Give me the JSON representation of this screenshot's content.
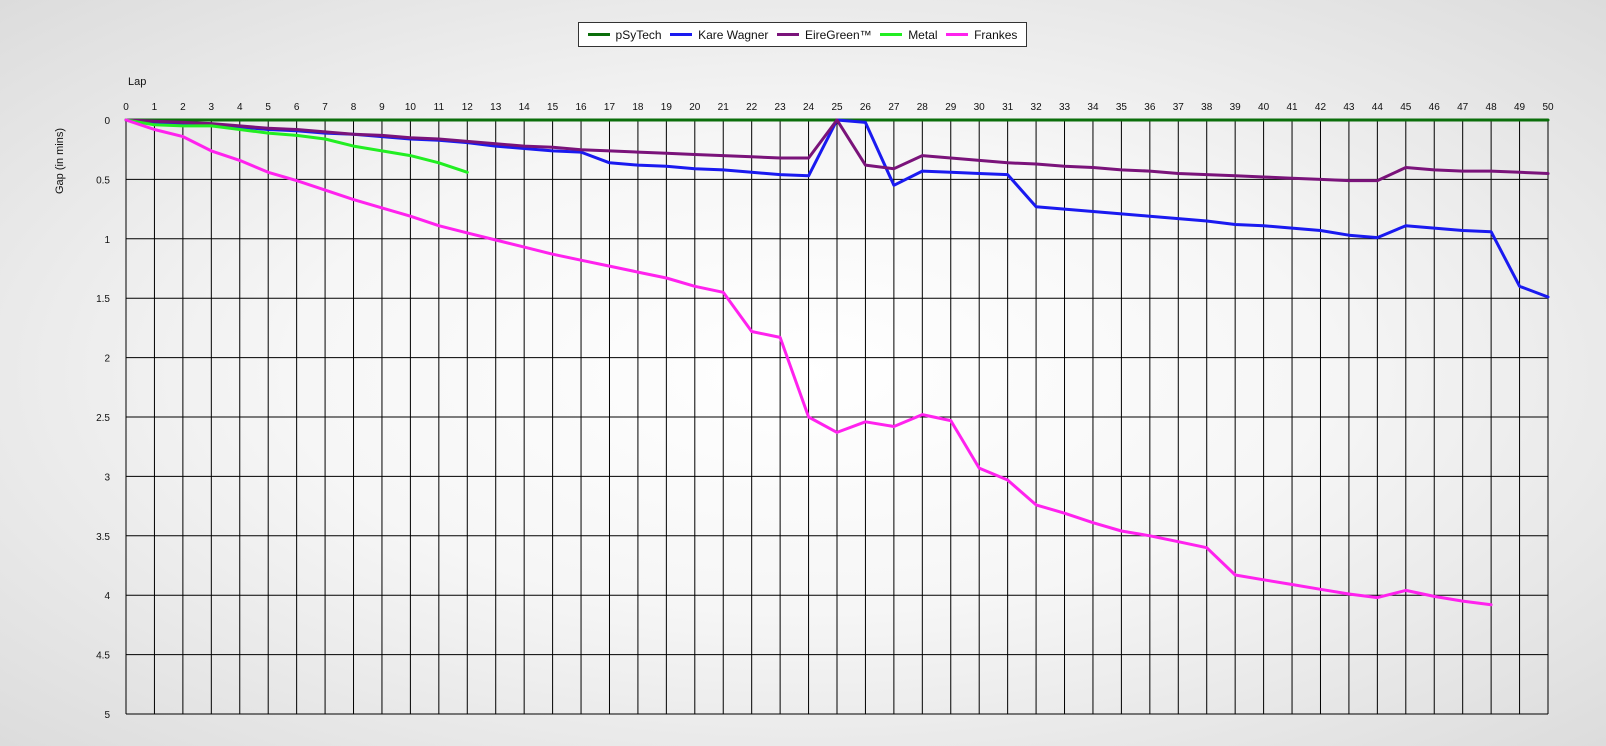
{
  "chart_data": {
    "type": "line",
    "xlabel": "Lap",
    "ylabel": "Gap (in mins)",
    "xlim": [
      0,
      50
    ],
    "ylim": [
      0,
      5
    ],
    "y_inverted": true,
    "grid": true,
    "legend_position": "top-center",
    "x_ticks": [
      0,
      1,
      2,
      3,
      4,
      5,
      6,
      7,
      8,
      9,
      10,
      11,
      12,
      13,
      14,
      15,
      16,
      17,
      18,
      19,
      20,
      21,
      22,
      23,
      24,
      25,
      26,
      27,
      28,
      29,
      30,
      31,
      32,
      33,
      34,
      35,
      36,
      37,
      38,
      39,
      40,
      41,
      42,
      43,
      44,
      45,
      46,
      47,
      48,
      49,
      50
    ],
    "y_ticks": [
      "0",
      "0.5",
      "1",
      "1.5",
      "2",
      "2.5",
      "3",
      "3.5",
      "4",
      "4.5",
      "5"
    ],
    "series": [
      {
        "name": "pSyTech",
        "color": "#0b6e0b",
        "x": [
          0,
          5,
          10,
          15,
          20,
          24,
          25,
          26,
          30,
          35,
          40,
          45,
          50
        ],
        "y": [
          0,
          0,
          0,
          0,
          0,
          0,
          0,
          0,
          0,
          0,
          0,
          0,
          0
        ]
      },
      {
        "name": "Kare Wagner",
        "color": "#1a1af0",
        "x": [
          0,
          1,
          2,
          3,
          4,
          5,
          6,
          7,
          8,
          9,
          10,
          11,
          12,
          13,
          14,
          15,
          16,
          17,
          18,
          19,
          20,
          21,
          22,
          23,
          24,
          25,
          26,
          27,
          28,
          29,
          30,
          31,
          32,
          33,
          34,
          35,
          36,
          37,
          38,
          39,
          40,
          41,
          42,
          43,
          44,
          45,
          46,
          47,
          48,
          49,
          50
        ],
        "y": [
          0,
          0.02,
          0.03,
          0.04,
          0.06,
          0.08,
          0.09,
          0.11,
          0.12,
          0.14,
          0.16,
          0.17,
          0.19,
          0.22,
          0.24,
          0.26,
          0.27,
          0.36,
          0.38,
          0.39,
          0.41,
          0.42,
          0.44,
          0.46,
          0.47,
          0.0,
          0.02,
          0.55,
          0.43,
          0.44,
          0.45,
          0.46,
          0.73,
          0.75,
          0.77,
          0.79,
          0.81,
          0.83,
          0.85,
          0.88,
          0.89,
          0.91,
          0.93,
          0.97,
          0.99,
          0.89,
          0.91,
          0.93,
          0.94,
          1.4,
          1.49
        ]
      },
      {
        "name": "EireGreen™",
        "color": "#7a137a",
        "x": [
          0,
          1,
          2,
          3,
          4,
          5,
          6,
          7,
          8,
          9,
          10,
          11,
          12,
          13,
          14,
          15,
          16,
          17,
          18,
          19,
          20,
          21,
          22,
          23,
          24,
          25,
          26,
          27,
          28,
          29,
          30,
          31,
          32,
          33,
          34,
          35,
          36,
          37,
          38,
          39,
          40,
          41,
          42,
          43,
          44,
          45,
          46,
          47,
          48,
          49,
          50
        ],
        "y": [
          0,
          0.01,
          0.02,
          0.03,
          0.05,
          0.07,
          0.08,
          0.1,
          0.12,
          0.13,
          0.15,
          0.16,
          0.18,
          0.2,
          0.22,
          0.23,
          0.25,
          0.26,
          0.27,
          0.28,
          0.29,
          0.3,
          0.31,
          0.32,
          0.32,
          0.0,
          0.38,
          0.41,
          0.3,
          0.32,
          0.34,
          0.36,
          0.37,
          0.39,
          0.4,
          0.42,
          0.43,
          0.45,
          0.46,
          0.47,
          0.48,
          0.49,
          0.5,
          0.51,
          0.51,
          0.4,
          0.42,
          0.43,
          0.43,
          0.44,
          0.45
        ]
      },
      {
        "name": "Metal",
        "color": "#22ee22",
        "x": [
          0,
          1,
          2,
          3,
          4,
          5,
          6,
          7,
          8,
          9,
          10,
          11,
          12
        ],
        "y": [
          0,
          0.04,
          0.05,
          0.05,
          0.08,
          0.11,
          0.13,
          0.16,
          0.22,
          0.26,
          0.3,
          0.36,
          0.44
        ]
      },
      {
        "name": "Frankes",
        "color": "#ff22ee",
        "x": [
          0,
          1,
          2,
          3,
          4,
          5,
          6,
          7,
          8,
          9,
          10,
          11,
          12,
          13,
          14,
          15,
          16,
          17,
          18,
          19,
          20,
          21,
          22,
          23,
          24,
          25,
          26,
          27,
          28,
          29,
          30,
          31,
          32,
          33,
          34,
          35,
          36,
          37,
          38,
          39,
          40,
          41,
          42,
          43,
          44,
          45,
          46,
          47,
          48
        ],
        "y": [
          0,
          0.08,
          0.14,
          0.26,
          0.34,
          0.44,
          0.51,
          0.59,
          0.67,
          0.74,
          0.81,
          0.89,
          0.95,
          1.01,
          1.07,
          1.13,
          1.18,
          1.23,
          1.28,
          1.33,
          1.4,
          1.45,
          1.78,
          1.83,
          2.5,
          2.63,
          2.54,
          2.58,
          2.48,
          2.53,
          2.93,
          3.03,
          3.24,
          3.31,
          3.39,
          3.46,
          3.5,
          3.55,
          3.6,
          3.83,
          3.87,
          3.91,
          3.95,
          3.99,
          4.02,
          3.96,
          4.01,
          4.05,
          4.08
        ]
      }
    ]
  }
}
